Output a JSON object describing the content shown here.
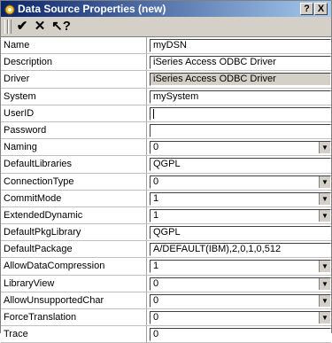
{
  "window": {
    "title": "Data Source Properties (new)",
    "help_button": "?",
    "close_button": "X"
  },
  "toolbar": {
    "ok_icon": "✔",
    "cancel_icon": "✕",
    "help_icon": "↖?"
  },
  "properties": [
    {
      "label": "Name",
      "value": "myDSN",
      "type": "text"
    },
    {
      "label": "Description",
      "value": "iSeries Access ODBC Driver",
      "type": "text"
    },
    {
      "label": "Driver",
      "value": "iSeries Access ODBC Driver",
      "type": "readonly"
    },
    {
      "label": "System",
      "value": "mySystem",
      "type": "text"
    },
    {
      "label": "UserID",
      "value": "",
      "type": "text-focus"
    },
    {
      "label": "Password",
      "value": "",
      "type": "text"
    },
    {
      "label": "Naming",
      "value": "0",
      "type": "select"
    },
    {
      "label": "DefaultLibraries",
      "value": "QGPL",
      "type": "text"
    },
    {
      "label": "ConnectionType",
      "value": "0",
      "type": "select"
    },
    {
      "label": "CommitMode",
      "value": "1",
      "type": "select"
    },
    {
      "label": "ExtendedDynamic",
      "value": "1",
      "type": "select"
    },
    {
      "label": "DefaultPkgLibrary",
      "value": "QGPL",
      "type": "text"
    },
    {
      "label": "DefaultPackage",
      "value": "A/DEFAULT(IBM),2,0,1,0,512",
      "type": "text"
    },
    {
      "label": "AllowDataCompression",
      "value": "1",
      "type": "select"
    },
    {
      "label": "LibraryView",
      "value": "0",
      "type": "select"
    },
    {
      "label": "AllowUnsupportedChar",
      "value": "0",
      "type": "select"
    },
    {
      "label": "ForceTranslation",
      "value": "0",
      "type": "select"
    },
    {
      "label": "Trace",
      "value": "0",
      "type": "text"
    }
  ]
}
